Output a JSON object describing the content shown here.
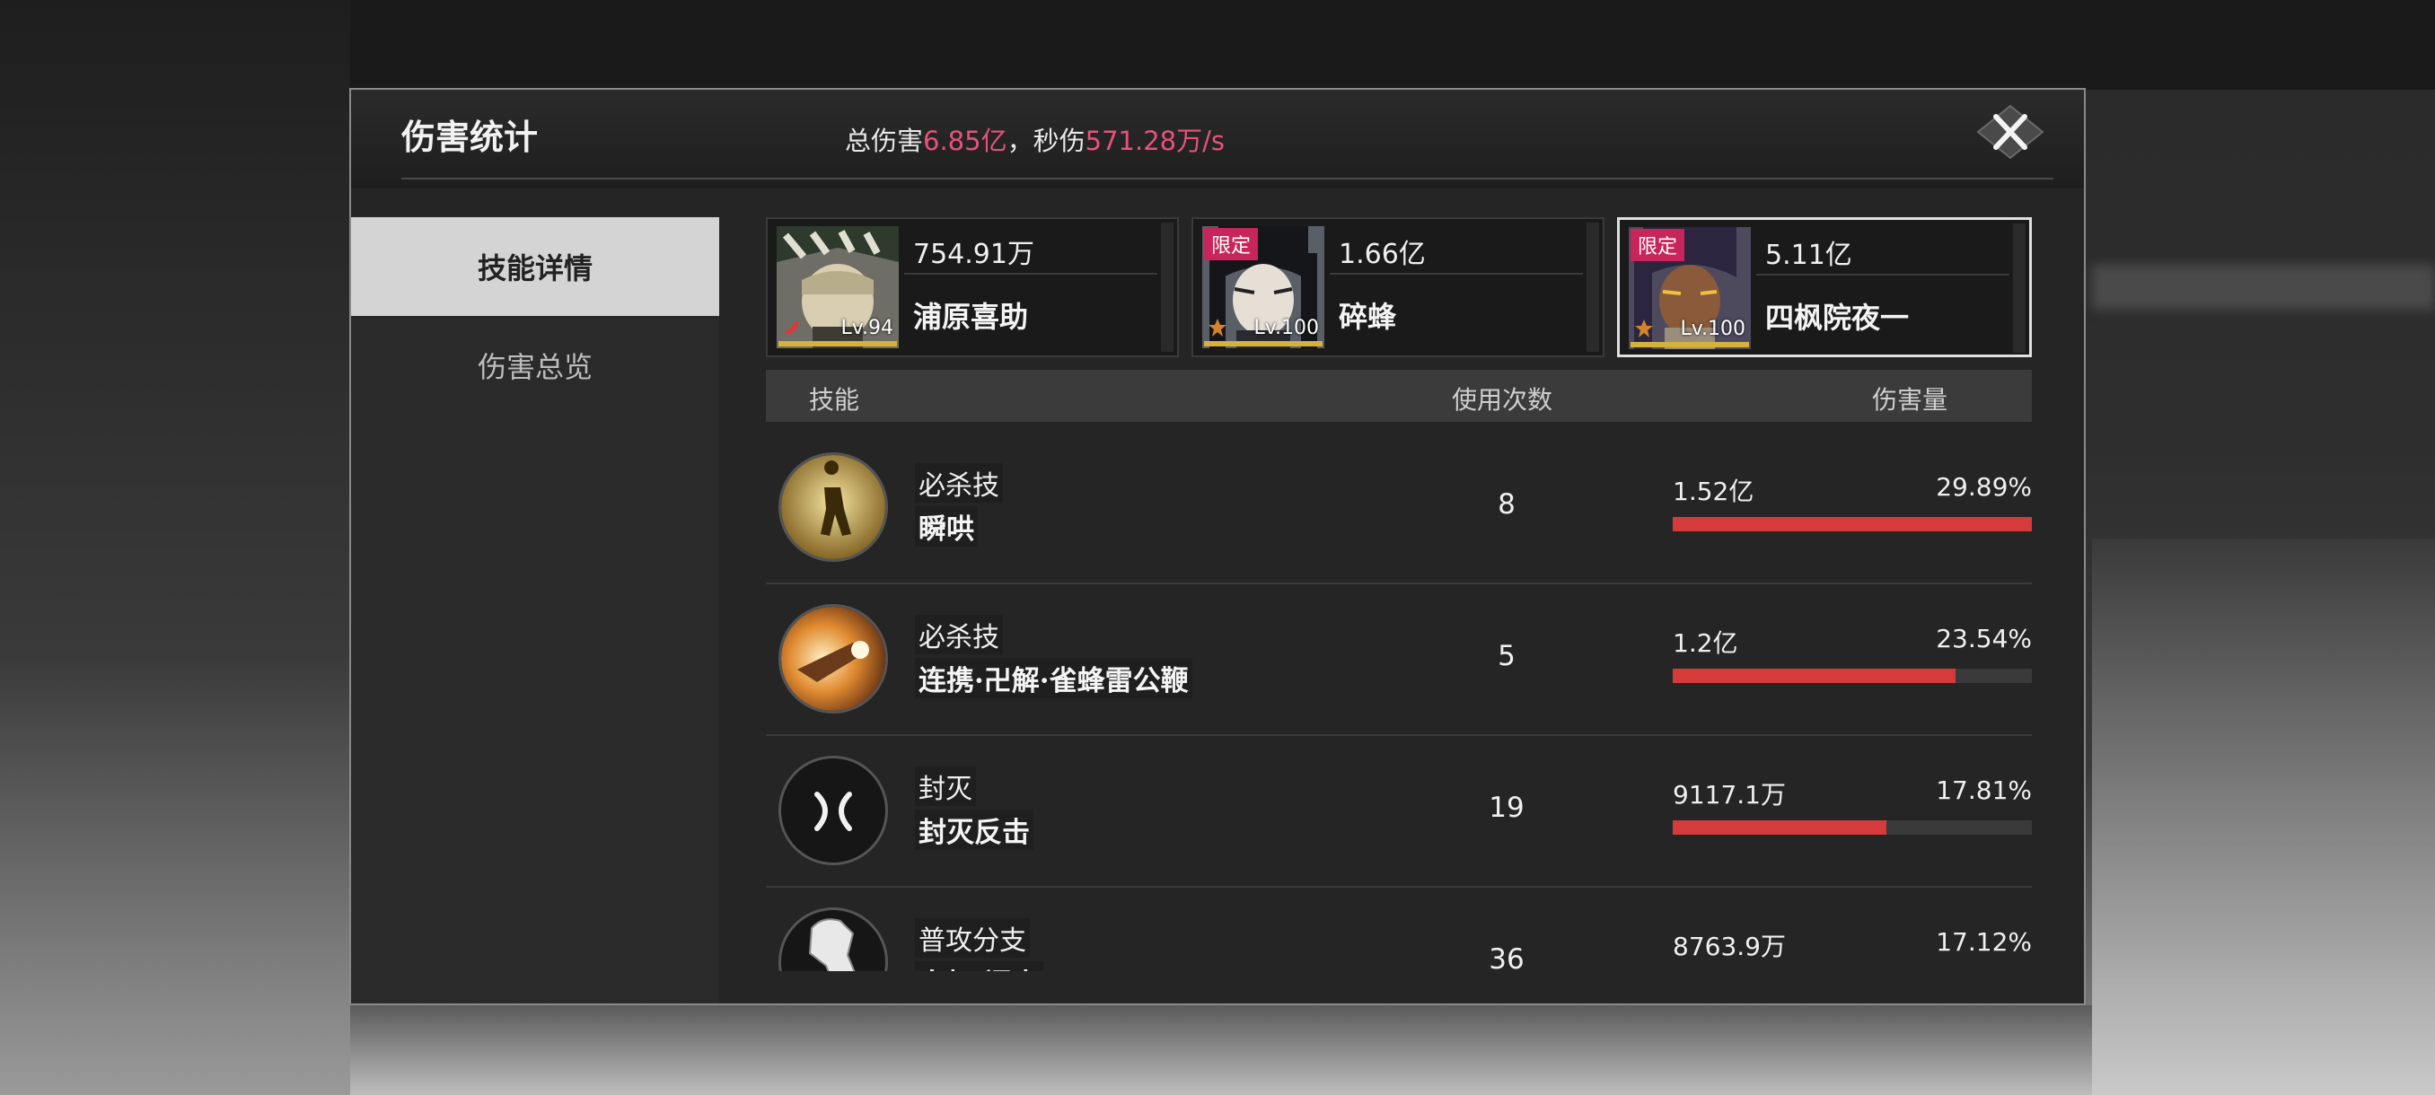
{
  "dialog": {
    "title": "伤害统计",
    "total_label": "总伤害",
    "total_value": "6.85亿",
    "separator": "，",
    "dps_label": "秒伤",
    "dps_value": "571.28万/s"
  },
  "sidebar": {
    "items": [
      {
        "label": "技能详情",
        "active": true
      },
      {
        "label": "伤害总览",
        "active": false
      }
    ]
  },
  "characters": [
    {
      "damage": "754.91万",
      "name": "浦原喜助",
      "level": "Lv.94",
      "limited": ""
    },
    {
      "damage": "1.66亿",
      "name": "碎蜂",
      "level": "Lv.100",
      "limited": "限定"
    },
    {
      "damage": "5.11亿",
      "name": "四枫院夜一",
      "level": "Lv.100",
      "limited": "限定",
      "selected": true
    }
  ],
  "table": {
    "headers": {
      "skill": "技能",
      "count": "使用次数",
      "damage": "伤害量"
    },
    "rows": [
      {
        "type": "必杀技",
        "name": "瞬哄",
        "count": "8",
        "damage": "1.52亿",
        "percent": "29.89%",
        "fraction": 0.2989,
        "icon": "ultimate-silhouette-icon"
      },
      {
        "type": "必杀技",
        "name": "连携·卍解·雀蜂雷公鞭",
        "count": "5",
        "damage": "1.2亿",
        "percent": "23.54%",
        "fraction": 0.2354,
        "icon": "bankai-cannon-icon"
      },
      {
        "type": "封灭",
        "name": "封灭反击",
        "count": "19",
        "damage": "9117.1万",
        "percent": "17.81%",
        "fraction": 0.1781,
        "icon": "seal-counter-icon"
      },
      {
        "type": "普攻分支",
        "name": "白打·闪击",
        "count": "36",
        "damage": "8763.9万",
        "percent": "17.12%",
        "fraction": 0.1712,
        "icon": "fist-icon"
      }
    ]
  },
  "colors": {
    "accent_pink": "#e8527a",
    "bar_red": "#d63b3b",
    "limited_tag": "#c8255a"
  }
}
